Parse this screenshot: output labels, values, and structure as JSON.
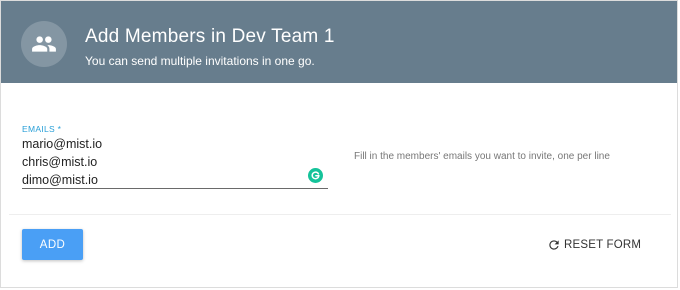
{
  "header": {
    "title": "Add Members in Dev Team 1",
    "subtitle": "You can send multiple invitations in one go.",
    "icon": "group-icon",
    "background_color": "#677d8d"
  },
  "form": {
    "emails_label": "EMAILS *",
    "emails_value": "mario@mist.io\nchris@mist.io\ndimo@mist.io",
    "helper_text": "Fill in the members' emails you want to invite, one per line",
    "grammar_icon": "grammarly-icon",
    "label_color": "#2aa0d8"
  },
  "actions": {
    "add_label": "ADD",
    "reset_label": "RESET FORM",
    "reset_icon": "refresh-icon",
    "primary_color": "#4a9ff5"
  }
}
